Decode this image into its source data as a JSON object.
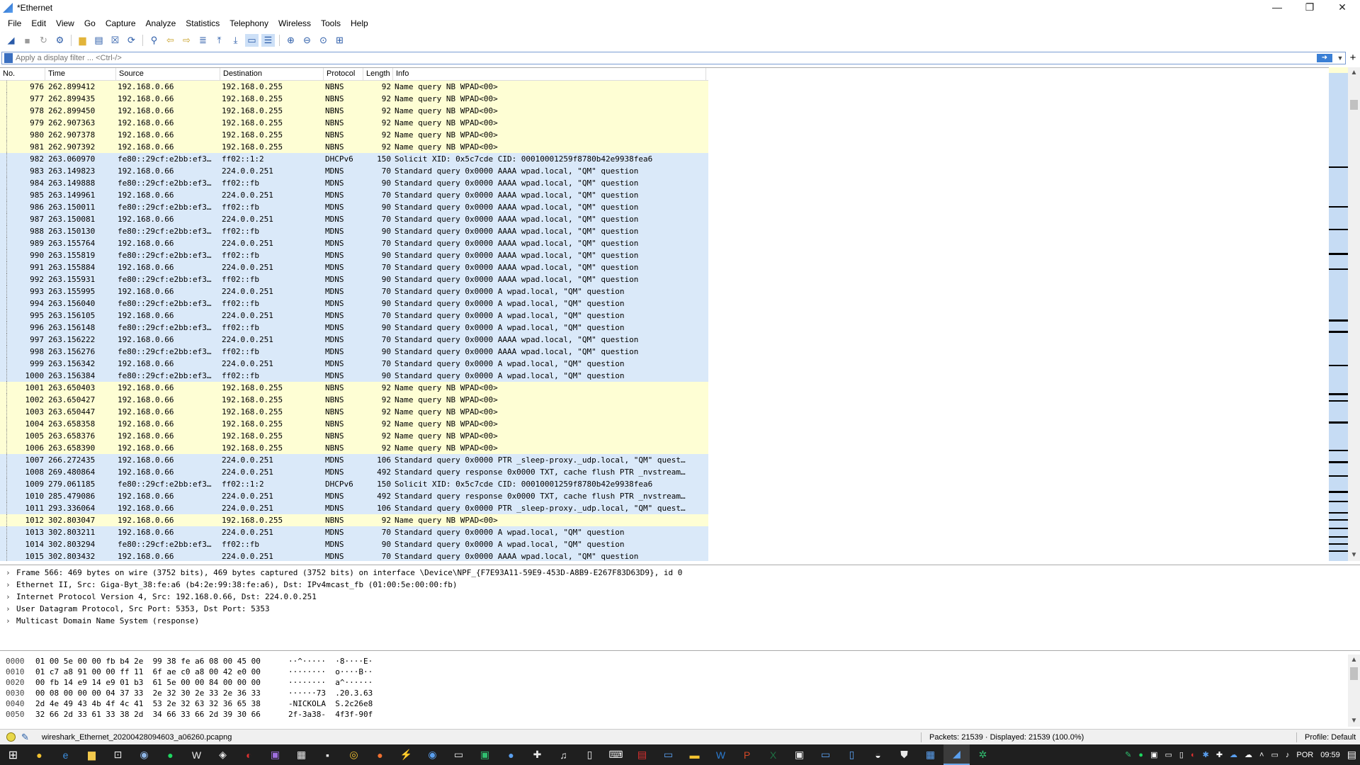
{
  "window": {
    "title": "*Ethernet",
    "minimize": "—",
    "maximize": "❐",
    "close": "✕"
  },
  "menu": [
    "File",
    "Edit",
    "View",
    "Go",
    "Capture",
    "Analyze",
    "Statistics",
    "Telephony",
    "Wireless",
    "Tools",
    "Help"
  ],
  "filter": {
    "placeholder": "Apply a display filter ... <Ctrl-/>",
    "plus": "+"
  },
  "columns": {
    "no": "No.",
    "time": "Time",
    "source": "Source",
    "destination": "Destination",
    "protocol": "Protocol",
    "length": "Length",
    "info": "Info"
  },
  "packets": [
    {
      "no": "976",
      "time": "262.899412",
      "src": "192.168.0.66",
      "dst": "192.168.0.255",
      "proto": "NBNS",
      "len": "92",
      "info": "Name query NB WPAD<00>"
    },
    {
      "no": "977",
      "time": "262.899435",
      "src": "192.168.0.66",
      "dst": "192.168.0.255",
      "proto": "NBNS",
      "len": "92",
      "info": "Name query NB WPAD<00>"
    },
    {
      "no": "978",
      "time": "262.899450",
      "src": "192.168.0.66",
      "dst": "192.168.0.255",
      "proto": "NBNS",
      "len": "92",
      "info": "Name query NB WPAD<00>"
    },
    {
      "no": "979",
      "time": "262.907363",
      "src": "192.168.0.66",
      "dst": "192.168.0.255",
      "proto": "NBNS",
      "len": "92",
      "info": "Name query NB WPAD<00>"
    },
    {
      "no": "980",
      "time": "262.907378",
      "src": "192.168.0.66",
      "dst": "192.168.0.255",
      "proto": "NBNS",
      "len": "92",
      "info": "Name query NB WPAD<00>"
    },
    {
      "no": "981",
      "time": "262.907392",
      "src": "192.168.0.66",
      "dst": "192.168.0.255",
      "proto": "NBNS",
      "len": "92",
      "info": "Name query NB WPAD<00>"
    },
    {
      "no": "982",
      "time": "263.060970",
      "src": "fe80::29cf:e2bb:ef3…",
      "dst": "ff02::1:2",
      "proto": "DHCPv6",
      "len": "150",
      "info": "Solicit XID: 0x5c7cde CID: 00010001259f8780b42e9938fea6"
    },
    {
      "no": "983",
      "time": "263.149823",
      "src": "192.168.0.66",
      "dst": "224.0.0.251",
      "proto": "MDNS",
      "len": "70",
      "info": "Standard query 0x0000 AAAA wpad.local, \"QM\" question"
    },
    {
      "no": "984",
      "time": "263.149888",
      "src": "fe80::29cf:e2bb:ef3…",
      "dst": "ff02::fb",
      "proto": "MDNS",
      "len": "90",
      "info": "Standard query 0x0000 AAAA wpad.local, \"QM\" question"
    },
    {
      "no": "985",
      "time": "263.149961",
      "src": "192.168.0.66",
      "dst": "224.0.0.251",
      "proto": "MDNS",
      "len": "70",
      "info": "Standard query 0x0000 AAAA wpad.local, \"QM\" question"
    },
    {
      "no": "986",
      "time": "263.150011",
      "src": "fe80::29cf:e2bb:ef3…",
      "dst": "ff02::fb",
      "proto": "MDNS",
      "len": "90",
      "info": "Standard query 0x0000 AAAA wpad.local, \"QM\" question"
    },
    {
      "no": "987",
      "time": "263.150081",
      "src": "192.168.0.66",
      "dst": "224.0.0.251",
      "proto": "MDNS",
      "len": "70",
      "info": "Standard query 0x0000 AAAA wpad.local, \"QM\" question"
    },
    {
      "no": "988",
      "time": "263.150130",
      "src": "fe80::29cf:e2bb:ef3…",
      "dst": "ff02::fb",
      "proto": "MDNS",
      "len": "90",
      "info": "Standard query 0x0000 AAAA wpad.local, \"QM\" question"
    },
    {
      "no": "989",
      "time": "263.155764",
      "src": "192.168.0.66",
      "dst": "224.0.0.251",
      "proto": "MDNS",
      "len": "70",
      "info": "Standard query 0x0000 AAAA wpad.local, \"QM\" question"
    },
    {
      "no": "990",
      "time": "263.155819",
      "src": "fe80::29cf:e2bb:ef3…",
      "dst": "ff02::fb",
      "proto": "MDNS",
      "len": "90",
      "info": "Standard query 0x0000 AAAA wpad.local, \"QM\" question"
    },
    {
      "no": "991",
      "time": "263.155884",
      "src": "192.168.0.66",
      "dst": "224.0.0.251",
      "proto": "MDNS",
      "len": "70",
      "info": "Standard query 0x0000 AAAA wpad.local, \"QM\" question"
    },
    {
      "no": "992",
      "time": "263.155931",
      "src": "fe80::29cf:e2bb:ef3…",
      "dst": "ff02::fb",
      "proto": "MDNS",
      "len": "90",
      "info": "Standard query 0x0000 AAAA wpad.local, \"QM\" question"
    },
    {
      "no": "993",
      "time": "263.155995",
      "src": "192.168.0.66",
      "dst": "224.0.0.251",
      "proto": "MDNS",
      "len": "70",
      "info": "Standard query 0x0000 A wpad.local, \"QM\" question"
    },
    {
      "no": "994",
      "time": "263.156040",
      "src": "fe80::29cf:e2bb:ef3…",
      "dst": "ff02::fb",
      "proto": "MDNS",
      "len": "90",
      "info": "Standard query 0x0000 A wpad.local, \"QM\" question"
    },
    {
      "no": "995",
      "time": "263.156105",
      "src": "192.168.0.66",
      "dst": "224.0.0.251",
      "proto": "MDNS",
      "len": "70",
      "info": "Standard query 0x0000 A wpad.local, \"QM\" question"
    },
    {
      "no": "996",
      "time": "263.156148",
      "src": "fe80::29cf:e2bb:ef3…",
      "dst": "ff02::fb",
      "proto": "MDNS",
      "len": "90",
      "info": "Standard query 0x0000 A wpad.local, \"QM\" question"
    },
    {
      "no": "997",
      "time": "263.156222",
      "src": "192.168.0.66",
      "dst": "224.0.0.251",
      "proto": "MDNS",
      "len": "70",
      "info": "Standard query 0x0000 AAAA wpad.local, \"QM\" question"
    },
    {
      "no": "998",
      "time": "263.156276",
      "src": "fe80::29cf:e2bb:ef3…",
      "dst": "ff02::fb",
      "proto": "MDNS",
      "len": "90",
      "info": "Standard query 0x0000 AAAA wpad.local, \"QM\" question"
    },
    {
      "no": "999",
      "time": "263.156342",
      "src": "192.168.0.66",
      "dst": "224.0.0.251",
      "proto": "MDNS",
      "len": "70",
      "info": "Standard query 0x0000 A wpad.local, \"QM\" question"
    },
    {
      "no": "1000",
      "time": "263.156384",
      "src": "fe80::29cf:e2bb:ef3…",
      "dst": "ff02::fb",
      "proto": "MDNS",
      "len": "90",
      "info": "Standard query 0x0000 A wpad.local, \"QM\" question"
    },
    {
      "no": "1001",
      "time": "263.650403",
      "src": "192.168.0.66",
      "dst": "192.168.0.255",
      "proto": "NBNS",
      "len": "92",
      "info": "Name query NB WPAD<00>"
    },
    {
      "no": "1002",
      "time": "263.650427",
      "src": "192.168.0.66",
      "dst": "192.168.0.255",
      "proto": "NBNS",
      "len": "92",
      "info": "Name query NB WPAD<00>"
    },
    {
      "no": "1003",
      "time": "263.650447",
      "src": "192.168.0.66",
      "dst": "192.168.0.255",
      "proto": "NBNS",
      "len": "92",
      "info": "Name query NB WPAD<00>"
    },
    {
      "no": "1004",
      "time": "263.658358",
      "src": "192.168.0.66",
      "dst": "192.168.0.255",
      "proto": "NBNS",
      "len": "92",
      "info": "Name query NB WPAD<00>"
    },
    {
      "no": "1005",
      "time": "263.658376",
      "src": "192.168.0.66",
      "dst": "192.168.0.255",
      "proto": "NBNS",
      "len": "92",
      "info": "Name query NB WPAD<00>"
    },
    {
      "no": "1006",
      "time": "263.658390",
      "src": "192.168.0.66",
      "dst": "192.168.0.255",
      "proto": "NBNS",
      "len": "92",
      "info": "Name query NB WPAD<00>"
    },
    {
      "no": "1007",
      "time": "266.272435",
      "src": "192.168.0.66",
      "dst": "224.0.0.251",
      "proto": "MDNS",
      "len": "106",
      "info": "Standard query 0x0000 PTR _sleep-proxy._udp.local, \"QM\" quest…"
    },
    {
      "no": "1008",
      "time": "269.480864",
      "src": "192.168.0.66",
      "dst": "224.0.0.251",
      "proto": "MDNS",
      "len": "492",
      "info": "Standard query response 0x0000 TXT, cache flush PTR _nvstream…"
    },
    {
      "no": "1009",
      "time": "279.061185",
      "src": "fe80::29cf:e2bb:ef3…",
      "dst": "ff02::1:2",
      "proto": "DHCPv6",
      "len": "150",
      "info": "Solicit XID: 0x5c7cde CID: 00010001259f8780b42e9938fea6"
    },
    {
      "no": "1010",
      "time": "285.479086",
      "src": "192.168.0.66",
      "dst": "224.0.0.251",
      "proto": "MDNS",
      "len": "492",
      "info": "Standard query response 0x0000 TXT, cache flush PTR _nvstream…"
    },
    {
      "no": "1011",
      "time": "293.336064",
      "src": "192.168.0.66",
      "dst": "224.0.0.251",
      "proto": "MDNS",
      "len": "106",
      "info": "Standard query 0x0000 PTR _sleep-proxy._udp.local, \"QM\" quest…"
    },
    {
      "no": "1012",
      "time": "302.803047",
      "src": "192.168.0.66",
      "dst": "192.168.0.255",
      "proto": "NBNS",
      "len": "92",
      "info": "Name query NB WPAD<00>"
    },
    {
      "no": "1013",
      "time": "302.803211",
      "src": "192.168.0.66",
      "dst": "224.0.0.251",
      "proto": "MDNS",
      "len": "70",
      "info": "Standard query 0x0000 A wpad.local, \"QM\" question"
    },
    {
      "no": "1014",
      "time": "302.803294",
      "src": "fe80::29cf:e2bb:ef3…",
      "dst": "ff02::fb",
      "proto": "MDNS",
      "len": "90",
      "info": "Standard query 0x0000 A wpad.local, \"QM\" question"
    },
    {
      "no": "1015",
      "time": "302.803432",
      "src": "192.168.0.66",
      "dst": "224.0.0.251",
      "proto": "MDNS",
      "len": "70",
      "info": "Standard query 0x0000 AAAA wpad.local, \"QM\" question"
    }
  ],
  "details": [
    "Frame 566: 469 bytes on wire (3752 bits), 469 bytes captured (3752 bits) on interface \\Device\\NPF_{F7E93A11-59E9-453D-A8B9-E267F83D63D9}, id 0",
    "Ethernet II, Src: Giga-Byt_38:fe:a6 (b4:2e:99:38:fe:a6), Dst: IPv4mcast_fb (01:00:5e:00:00:fb)",
    "Internet Protocol Version 4, Src: 192.168.0.66, Dst: 224.0.0.251",
    "User Datagram Protocol, Src Port: 5353, Dst Port: 5353",
    "Multicast Domain Name System (response)"
  ],
  "hex": [
    {
      "off": "0000",
      "hex": "01 00 5e 00 00 fb b4 2e  99 38 fe a6 08 00 45 00",
      "ascii": "··^·····  ·8····E·"
    },
    {
      "off": "0010",
      "hex": "01 c7 a8 91 00 00 ff 11  6f ae c0 a8 00 42 e0 00",
      "ascii": "········  o····B··"
    },
    {
      "off": "0020",
      "hex": "00 fb 14 e9 14 e9 01 b3  61 5e 00 00 84 00 00 00",
      "ascii": "········  a^······"
    },
    {
      "off": "0030",
      "hex": "00 08 00 00 00 04 37 33  2e 32 30 2e 33 2e 36 33",
      "ascii": "······73  .20.3.63"
    },
    {
      "off": "0040",
      "hex": "2d 4e 49 43 4b 4f 4c 41  53 2e 32 63 32 36 65 38",
      "ascii": "-NICKOLA  S.2c26e8"
    },
    {
      "off": "0050",
      "hex": "32 66 2d 33 61 33 38 2d  34 66 33 66 2d 39 30 66",
      "ascii": "2f-3a38-  4f3f-90f"
    }
  ],
  "status": {
    "file": "wireshark_Ethernet_20200428094603_a06260.pcapng",
    "packets": "Packets: 21539 · Displayed: 21539 (100.0%)",
    "profile": "Profile: Default"
  },
  "tray": {
    "lang": "POR",
    "time": "09:59"
  },
  "colors": {
    "nbns_row": "#fefed4",
    "mdns_row": "#dae9f9",
    "minimap": "#c6dcf4",
    "taskbar": "#1f1f1f"
  }
}
